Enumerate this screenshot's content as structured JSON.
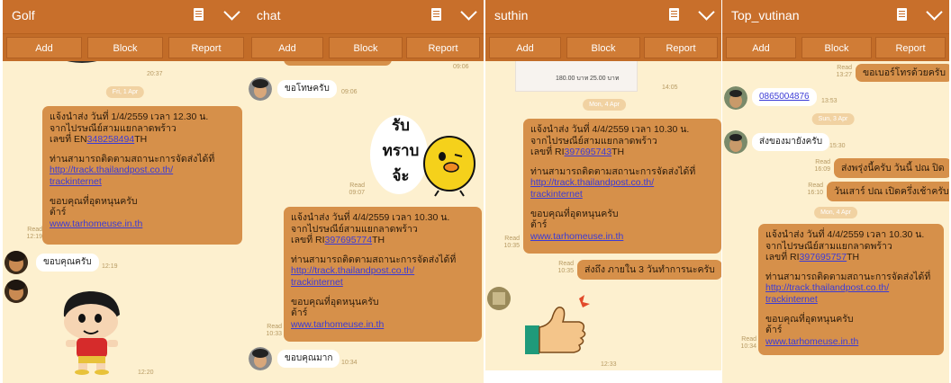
{
  "buttons": {
    "add": "Add",
    "block": "Block",
    "report": "Report"
  },
  "status": {
    "read": "Read"
  },
  "shipping": {
    "ship_prefix": "แจ้งนำส่ง วันที่ ",
    "time_prefix": " เวลา ",
    "branch": "จากไปรษณีย์สามแยกลาดพร้าว",
    "tracking_prefix": "เลขที่ ",
    "track_info": "ท่านสามารถติดตามสถานะการจัดส่งได้ที่",
    "track_link_1": "http://track.thailandpost.co.th/",
    "track_link_2": "trackinternet",
    "thanks": "ขอบคุณที่อุดหนุนครับ",
    "thanks_2": "ต้าร์",
    "website": "www.tarhomeuse.in.th"
  },
  "panels": [
    {
      "title": "Golf",
      "date_1": "Fri, 1 Apr",
      "time_top": "20:37",
      "ship_date": "1/4/2559",
      "ship_time": "12.30 น.",
      "tracking_letters": "EN",
      "tracking_digits": "348258494",
      "tracking_suffix": "TH",
      "ship_msg_time": "12:19",
      "reply_text": "ขอบคุณครับ",
      "reply_time": "12:19",
      "sticker_time": "12:20"
    },
    {
      "title": "chat",
      "time_top": "09:06",
      "msg_1": "ขอโทษครับ",
      "msg_1_time": "09:06",
      "sticker_time": "09:07",
      "sticker_text": [
        "รับ",
        "ทราบ",
        "จ้ะ"
      ],
      "ship_date": "4/4/2559",
      "ship_time": "10.30 น.",
      "tracking_letters": "RI",
      "tracking_digits": "397695774",
      "tracking_suffix": "TH",
      "ship_msg_time": "10:33",
      "msg_2": "ขอบคุณมาก",
      "msg_2_time": "10:34"
    },
    {
      "title": "suthin",
      "price_1": "180.00 บาท",
      "price_2": "25.00 บาท",
      "image_time": "14:05",
      "date_1": "Mon, 4 Apr",
      "ship_date": "4/4/2559",
      "ship_time": "10.30 น.",
      "tracking_letters": "RI",
      "tracking_digits": "397695743",
      "tracking_suffix": "TH",
      "ship_msg_time": "10:35",
      "msg_2": "ส่งถึง ภายใน 3 วันทำการนะครับ",
      "msg_2_time": "10:35",
      "sticker_time": "12:33"
    },
    {
      "title": "Top_vutinan",
      "msg_top": "ขอเบอร์โทรด้วยครับ",
      "msg_top_time": "13:27",
      "phone": "0865004876",
      "phone_time": "13:53",
      "date_1": "Sun, 3 Apr",
      "msg_2": "ส่งของมายังครับ",
      "msg_2_time": "15:30",
      "msg_3": "ส่งพรุ่งนี้ครับ วันนี้ ปณ ปิด",
      "msg_3_time": "16:09",
      "msg_4": "วันเสาร์ ปณ เปิดครึ่งเช้าครับ",
      "msg_4_time": "16:10",
      "date_2": "Mon, 4 Apr",
      "ship_date": "4/4/2559",
      "ship_time": "10.30 น.",
      "tracking_letters": "RI",
      "tracking_digits": "397695757",
      "tracking_suffix": "TH",
      "ship_msg_time": "10:34"
    }
  ]
}
